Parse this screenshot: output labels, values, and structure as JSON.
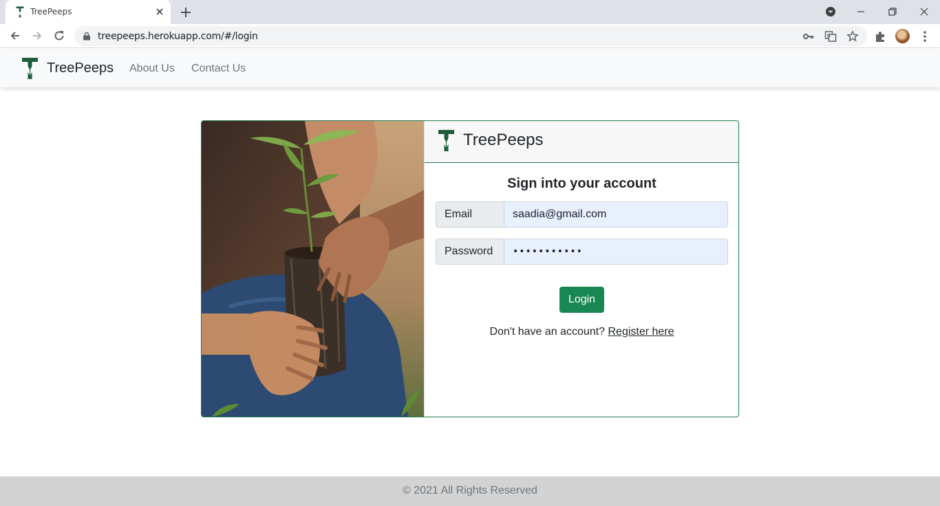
{
  "browser": {
    "tab_title": "TreePeeps",
    "url": "treepeeps.herokuapp.com/#/login"
  },
  "navbar": {
    "brand": "TreePeeps",
    "links": [
      "About Us",
      "Contact Us"
    ]
  },
  "login_card": {
    "brand": "TreePeeps",
    "title": "Sign into your account",
    "email_label": "Email",
    "email_value": "saadia@gmail.com",
    "password_label": "Password",
    "password_value": "•••••••••••",
    "login_button": "Login",
    "register_prompt": "Don't have an account? ",
    "register_link": "Register here"
  },
  "footer": {
    "text": "© 2021 All Rights Reserved"
  },
  "colors": {
    "brand_green": "#198754",
    "logo_green": "#1e5e3a",
    "card_border": "#1e7a4c"
  }
}
